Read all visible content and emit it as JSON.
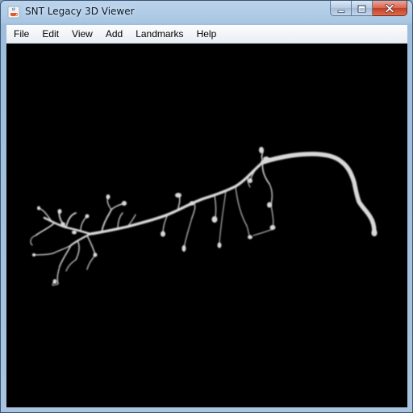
{
  "window": {
    "title": "SNT Legacy 3D Viewer",
    "app_icon": "java-cup-icon",
    "caption_buttons": [
      "minimize-icon",
      "maximize-icon",
      "close-icon"
    ]
  },
  "menubar": {
    "items": [
      "File",
      "Edit",
      "View",
      "Add",
      "Landmarks",
      "Help"
    ]
  },
  "viewer": {
    "background": "#000000",
    "neuron_color": "#d9d9d9",
    "content": "neuron-reconstruction"
  }
}
